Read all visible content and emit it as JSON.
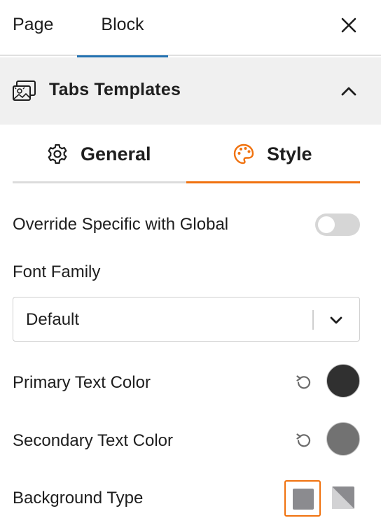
{
  "topbar": {
    "tabs": [
      "Page",
      "Block"
    ],
    "active_tab": "Block",
    "active_color": "#2271b1"
  },
  "panel": {
    "title": "Tabs Templates",
    "icon": "templates-icon",
    "expanded": true
  },
  "subtabs": {
    "general": {
      "label": "General",
      "icon": "gear-icon"
    },
    "style": {
      "label": "Style",
      "icon": "palette-icon"
    },
    "active": "Style",
    "accent": "#f0720f"
  },
  "settings": {
    "override_label": "Override Specific with Global",
    "override_enabled": false,
    "font_family_label": "Font Family",
    "font_family_value": "Default",
    "primary_color_label": "Primary Text Color",
    "primary_color_value": "#303030",
    "secondary_color_label": "Secondary Text Color",
    "secondary_color_value": "#727272",
    "background_type_label": "Background Type",
    "background_type_options": [
      "solid",
      "gradient"
    ],
    "background_type_selected": "solid"
  }
}
